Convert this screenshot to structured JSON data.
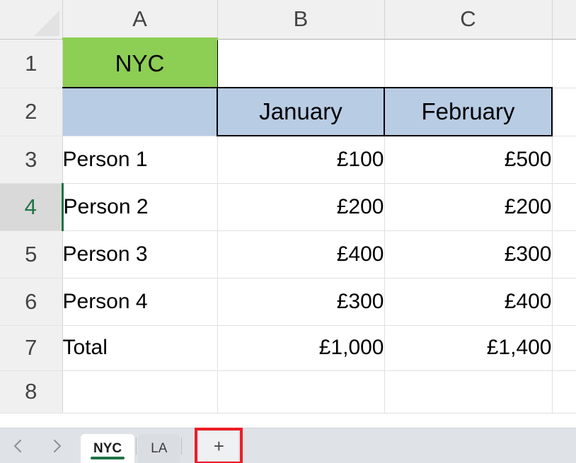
{
  "app": {
    "name": "Spreadsheet",
    "select_all_label": "Select All"
  },
  "grid": {
    "column_headers": [
      "A",
      "B",
      "C"
    ],
    "row_headers": [
      "1",
      "2",
      "3",
      "4",
      "5",
      "6",
      "7",
      "8"
    ],
    "active_cell_row": "4",
    "active_cell_column": "A",
    "cells": {
      "A1": "NYC",
      "B1": "",
      "C1": "",
      "A2": "",
      "B2": "January",
      "C2": "February",
      "A3": "Person 1",
      "B3": "£100",
      "C3": "£500",
      "A4": "Person 2",
      "B4": "£200",
      "C4": "£200",
      "A5": "Person 3",
      "B5": "£400",
      "C5": "£300",
      "A6": "Person 4",
      "B6": "£300",
      "C6": "£400",
      "A7": "Total",
      "B7": "£1,000",
      "C7": "£1,400",
      "A8": "",
      "B8": "",
      "C8": ""
    }
  },
  "colors": {
    "title_fill_green": "#8DCE55",
    "header_fill_blue": "#B8CCE4",
    "active_row_green": "#217346",
    "annotation_red": "#ee1c25",
    "header_gray": "#f0f0f0",
    "active_header_gray": "#d9d9d9"
  },
  "tabbar": {
    "prev_icon": "chevron-left-icon",
    "next_icon": "chevron-right-icon",
    "tabs": [
      {
        "label": "NYC",
        "active": true
      },
      {
        "label": "LA",
        "active": false
      }
    ],
    "add_sheet_label": "+",
    "annotation": "red-highlight-box"
  },
  "chart_data": {
    "type": "table",
    "title": "NYC",
    "categories": [
      "Person 1",
      "Person 2",
      "Person 3",
      "Person 4",
      "Total"
    ],
    "series": [
      {
        "name": "January",
        "values": [
          100,
          200,
          400,
          300,
          1000
        ]
      },
      {
        "name": "February",
        "values": [
          500,
          200,
          300,
          400,
          1400
        ]
      }
    ],
    "currency": "£",
    "xlabel": "",
    "ylabel": ""
  }
}
